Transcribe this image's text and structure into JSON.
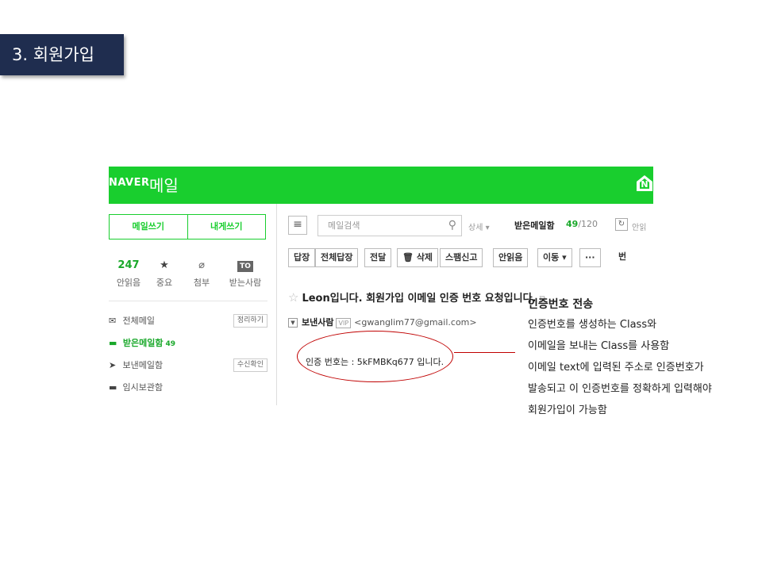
{
  "slide": {
    "section_title": "3. 회원가입"
  },
  "mail": {
    "brand": "NAVER",
    "brand_mail": "메일",
    "sidebar": {
      "write_button": "메일쓰기",
      "self_button": "내게쓰기",
      "quick": [
        {
          "top": "247",
          "label": "안읽음"
        },
        {
          "icon": "star-icon",
          "label": "중요"
        },
        {
          "icon": "paperclip-icon",
          "label": "첨부"
        },
        {
          "badge": "TO",
          "label": "받는사람"
        }
      ],
      "folders": [
        {
          "icon": "envelope-icon",
          "label": "전체메일",
          "tag": "정리하기"
        },
        {
          "icon": "inbox-icon",
          "label": "받은메일함",
          "count": "49"
        },
        {
          "icon": "send-icon",
          "label": "보낸메일함",
          "tag": "수신확인"
        },
        {
          "icon": "folder-icon",
          "label": "임시보관함"
        }
      ]
    },
    "search": {
      "placeholder": "메일검색",
      "scope": "상세 ▾"
    },
    "inbox": {
      "label": "받은메일함",
      "unread": "49",
      "total": "/120",
      "more": "안읽"
    },
    "toolbar": [
      "답장",
      "전체답장",
      "전달",
      "삭제",
      "스팸신고",
      "안읽음",
      "이동 ▾",
      "···",
      "번"
    ],
    "message": {
      "subject": "Leon입니다. 회원가입 이메일 인증 번호 요청입니다.",
      "sender_label": "보낸사람",
      "vip": "VIP",
      "sender_email": "<gwanglim77@gmail.com>",
      "body": "인증 번호는 : 5kFMBKq677 입니다."
    }
  },
  "annotation": {
    "title": "인증번호 전송",
    "lines": [
      "인증번호를 생성하는 Class와",
      "이메일을 보내는 Class를 사용함",
      "이메일 text에 입력된 주소로 인증번호가",
      "발송되고 이 인증번호를 정확하게 입력해야",
      "회원가입이 가능함"
    ]
  },
  "colors": {
    "naver_green": "#19ce2e",
    "title_bg": "#1f2d4f",
    "highlight_red": "#c00000"
  }
}
